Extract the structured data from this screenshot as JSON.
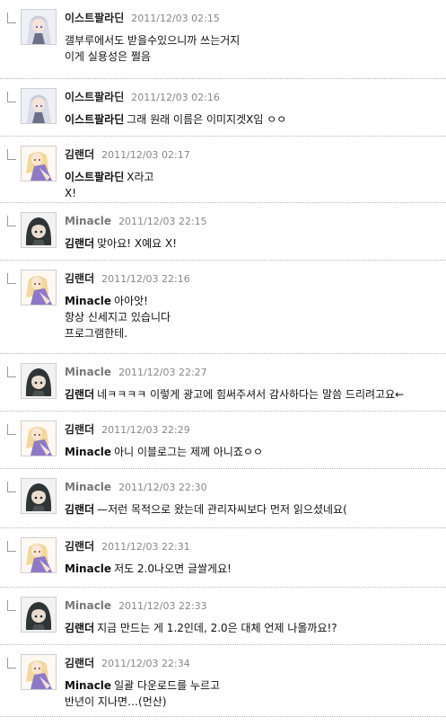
{
  "comments": [
    {
      "author": "이스트팔라딘",
      "author_style": "dark",
      "date": "2011/12/03 02:15",
      "avatar": "white-hair-anime-avatar-icon",
      "mention": "",
      "lines": [
        "갤부루에서도 받을수있으니까 쓰는거지",
        "이게 실용성은 쩔음"
      ]
    },
    {
      "author": "이스트팔라딘",
      "author_style": "dark",
      "date": "2011/12/03 02:16",
      "avatar": "white-hair-anime-avatar-icon",
      "mention": "이스트팔라딘",
      "lines": [
        "그래 원래 이름은 이미지겟X임 ㅇㅇ"
      ]
    },
    {
      "author": "김랜더",
      "author_style": "dark",
      "date": "2011/12/03 02:17",
      "avatar": "blonde-anime-avatar-icon",
      "mention": "이스트팔라딘",
      "lines": [
        "X라고",
        "X!"
      ]
    },
    {
      "author": "Minacle",
      "author_style": "gray",
      "date": "2011/12/03 22:15",
      "avatar": "hooded-figure-avatar-icon",
      "mention": "김랜더",
      "lines": [
        "맞아요! X예요 X!"
      ]
    },
    {
      "author": "김랜더",
      "author_style": "dark",
      "date": "2011/12/03 22:16",
      "avatar": "blonde-anime-avatar-icon",
      "mention": "Minacle",
      "lines": [
        "아아앗!",
        "항상 신세지고 있습니다",
        "프로그램한테."
      ]
    },
    {
      "author": "Minacle",
      "author_style": "gray",
      "date": "2011/12/03 22:27",
      "avatar": "hooded-figure-avatar-icon",
      "mention": "김랜더",
      "lines": [
        "네ㅋㅋㅋㅋ 이렇게 광고에 힘써주셔서 감사하다는 말씀 드리려고요←"
      ]
    },
    {
      "author": "김랜더",
      "author_style": "dark",
      "date": "2011/12/03 22:29",
      "avatar": "blonde-anime-avatar-icon",
      "mention": "Minacle",
      "lines": [
        "아니 이블로그는 제께 아니죠ㅇㅇ"
      ]
    },
    {
      "author": "Minacle",
      "author_style": "gray",
      "date": "2011/12/03 22:30",
      "avatar": "hooded-figure-avatar-icon",
      "mention": "김랜더",
      "lines": [
        "—저런 목적으로 왔는데 관리자씨보다 먼저 읽으셨네요("
      ]
    },
    {
      "author": "김랜더",
      "author_style": "dark",
      "date": "2011/12/03 22:31",
      "avatar": "blonde-anime-avatar-icon",
      "mention": "Minacle",
      "lines": [
        "저도 2.0나오면 글쌀게요!"
      ]
    },
    {
      "author": "Minacle",
      "author_style": "gray",
      "date": "2011/12/03 22:33",
      "avatar": "hooded-figure-avatar-icon",
      "mention": "김랜더",
      "lines": [
        "지금 만드는 게 1.2인데, 2.0은 대체 언제 나올까요!?"
      ]
    },
    {
      "author": "김랜더",
      "author_style": "dark",
      "date": "2011/12/03 22:34",
      "avatar": "blonde-anime-avatar-icon",
      "mention": "Minacle",
      "lines": [
        "일괄 다운로드를 누르고",
        "반년이 지나면…(먼산)"
      ]
    }
  ]
}
